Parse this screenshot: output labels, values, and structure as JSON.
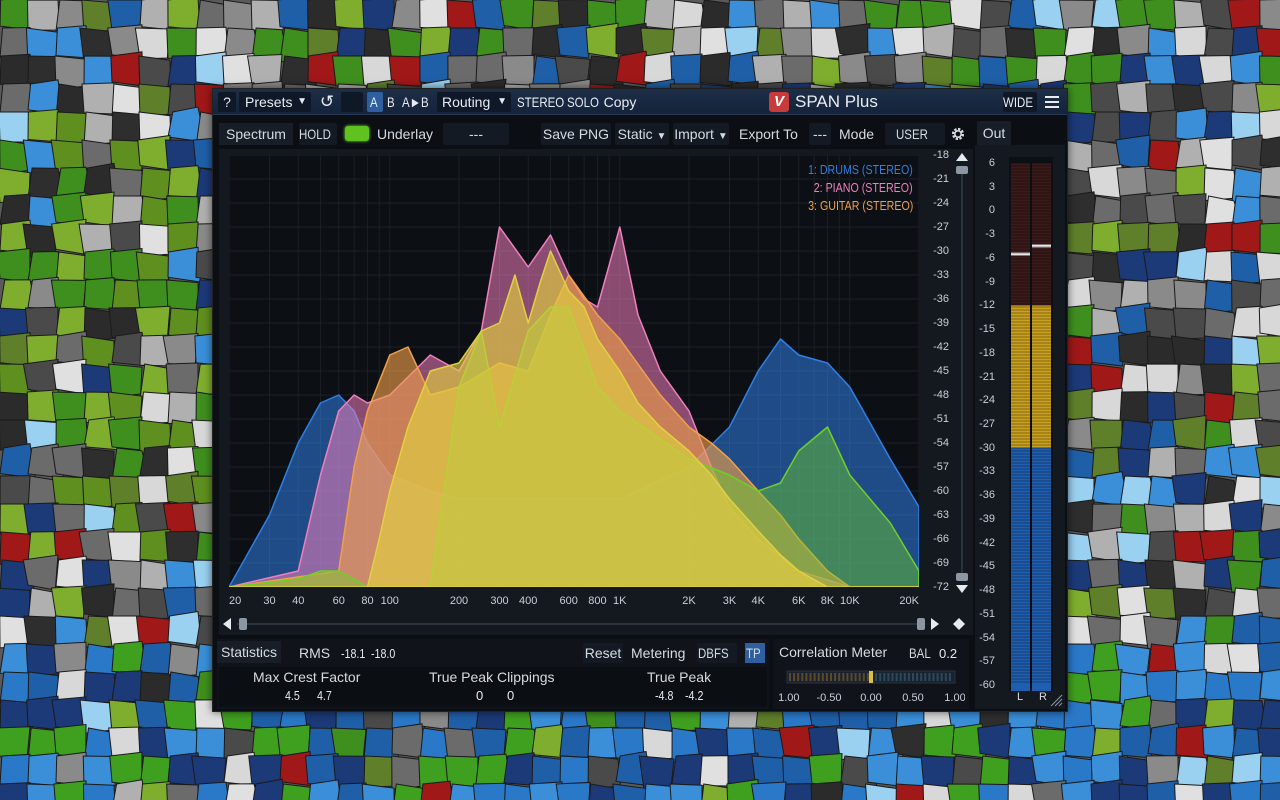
{
  "topbar": {
    "help": "?",
    "presets": "Presets",
    "undo_icon": "undo-icon",
    "slot_a": "A",
    "slot_b": "B",
    "a_to_b": "A►B",
    "routing": "Routing",
    "stereo": "STEREO",
    "solo": "SOLO",
    "copy": "Copy",
    "product": "SPAN Plus",
    "logo_letter": "V",
    "wide": "WIDE",
    "menu_icon": "hamburger-menu-icon"
  },
  "spectrum_header": {
    "tab": "Spectrum",
    "hold": "HOLD",
    "underlay_label": "Underlay",
    "underlay_value": "---",
    "save_png": "Save PNG",
    "static": "Static",
    "import": "Import",
    "export_to": "Export To",
    "export_value": "---",
    "mode_label": "Mode",
    "mode_value": "USER",
    "settings_icon": "gear-icon"
  },
  "out_tab": "Out",
  "legend": [
    {
      "label": "1: DRUMS (STEREO)",
      "color": "#2f7fe6"
    },
    {
      "label": "2: PIANO (STEREO)",
      "color": "#f07fbe"
    },
    {
      "label": "3: GUITAR (STEREO)",
      "color": "#f0a04a"
    }
  ],
  "chart_data": {
    "type": "area",
    "x_scale": "log",
    "xlabel": "",
    "ylabel": "",
    "xlim": [
      20,
      20000
    ],
    "ylim": [
      -72,
      -18
    ],
    "x_ticks": [
      "20",
      "30",
      "40",
      "60",
      "80",
      "100",
      "200",
      "300",
      "400",
      "600",
      "800",
      "1K",
      "2K",
      "3K",
      "4K",
      "6K",
      "8K",
      "10K",
      "20K"
    ],
    "y_ticks": [
      "-18",
      "-21",
      "-24",
      "-27",
      "-30",
      "-33",
      "-36",
      "-39",
      "-42",
      "-45",
      "-48",
      "-51",
      "-54",
      "-57",
      "-60",
      "-63",
      "-66",
      "-69",
      "-72"
    ],
    "series": [
      {
        "name": "1: DRUMS (STEREO)",
        "color": "#2f7fe6",
        "x": [
          20,
          30,
          40,
          50,
          60,
          70,
          80,
          100,
          150,
          200,
          300,
          400,
          600,
          800,
          1000,
          2000,
          3000,
          4000,
          5000,
          6000,
          8000,
          10000,
          15000,
          20000
        ],
        "y": [
          -72,
          -63,
          -54,
          -49,
          -48,
          -50,
          -54,
          -58,
          -60,
          -61,
          -61,
          -61,
          -61,
          -61,
          -61,
          -57,
          -52,
          -45,
          -41,
          -43,
          -44,
          -47,
          -56,
          -62
        ]
      },
      {
        "name": "2: PIANO (STEREO)",
        "color": "#f07fbe",
        "x": [
          20,
          40,
          50,
          60,
          70,
          80,
          100,
          150,
          200,
          250,
          300,
          400,
          500,
          600,
          700,
          800,
          1000,
          1200,
          1500,
          2000,
          2500,
          3000,
          4000,
          6000,
          10000,
          20000
        ],
        "y": [
          -72,
          -70,
          -58,
          -50,
          -48,
          -49,
          -48,
          -43,
          -45,
          -40,
          -27,
          -32,
          -28,
          -33,
          -36,
          -37,
          -27,
          -38,
          -45,
          -50,
          -57,
          -62,
          -66,
          -70,
          -72,
          -72
        ]
      },
      {
        "name": "3: GUITAR (STEREO)",
        "color": "#f0a04a",
        "x": [
          20,
          60,
          70,
          80,
          100,
          120,
          150,
          200,
          300,
          400,
          500,
          600,
          800,
          1000,
          1500,
          2000,
          2500,
          3000,
          4000,
          5000,
          6000,
          8000,
          10000,
          20000
        ],
        "y": [
          -72,
          -70,
          -57,
          -50,
          -43,
          -42,
          -48,
          -47,
          -44,
          -45,
          -38,
          -33,
          -38,
          -41,
          -48,
          -52,
          -54,
          -56,
          -60,
          -63,
          -66,
          -70,
          -72,
          -72
        ]
      },
      {
        "name": "",
        "color": "#e2d040",
        "x": [
          20,
          80,
          90,
          100,
          120,
          150,
          200,
          250,
          300,
          350,
          400,
          450,
          500,
          600,
          700,
          800,
          1000,
          1200,
          1500,
          2000,
          2500,
          3000,
          4000,
          5000,
          6000,
          8000,
          10000,
          15000,
          20000
        ],
        "y": [
          -72,
          -72,
          -66,
          -60,
          -52,
          -45,
          -44,
          -40,
          -39,
          -33,
          -39,
          -34,
          -30,
          -35,
          -37,
          -41,
          -45,
          -49,
          -52,
          -55,
          -58,
          -61,
          -65,
          -68,
          -70,
          -72,
          -72,
          -72,
          -72
        ]
      },
      {
        "name": "",
        "color": "#6fcf2a",
        "x": [
          20,
          40,
          50,
          60,
          70,
          80,
          100,
          150,
          200,
          250,
          300,
          400,
          500,
          600,
          800,
          1000,
          2000,
          3000,
          4000,
          5000,
          6000,
          8000,
          10000,
          15000,
          20000
        ],
        "y": [
          -72,
          -71,
          -70,
          -70,
          -71,
          -72,
          -72,
          -72,
          -47,
          -40,
          -52,
          -40,
          -37,
          -37,
          -47,
          -50,
          -56,
          -58,
          -60,
          -59,
          -55,
          -52,
          -58,
          -64,
          -70
        ]
      }
    ]
  },
  "statistics": {
    "tab": "Statistics",
    "rms_label": "RMS",
    "rms_l": "-18.1",
    "rms_r": "-18.0",
    "reset": "Reset",
    "metering_label": "Metering",
    "metering_value": "DBFS",
    "tp": "TP",
    "crest_label": "Max Crest Factor",
    "crest_l": "4.5",
    "crest_r": "4.7",
    "clip_label": "True Peak Clippings",
    "clip_l": "0",
    "clip_r": "0",
    "tpk_label": "True Peak",
    "tpk_l": "-4.8",
    "tpk_r": "-4.2"
  },
  "correlation": {
    "title": "Correlation Meter",
    "bal_label": "BAL",
    "bal_value": "0.2",
    "value": 0.0,
    "ticks": [
      "-1.00",
      "-0.50",
      "0.00",
      "0.50",
      "1.00"
    ]
  },
  "out_meter": {
    "ticks": [
      "6",
      "3",
      "0",
      "-3",
      "-6",
      "-9",
      "-12",
      "-15",
      "-18",
      "-21",
      "-24",
      "-27",
      "-30",
      "-33",
      "-36",
      "-39",
      "-42",
      "-45",
      "-48",
      "-51",
      "-54",
      "-57",
      "-60"
    ],
    "left_label": "L",
    "right_label": "R",
    "left_level_db": -12,
    "right_level_db": -12,
    "left_peak_db": -5.5,
    "right_peak_db": -4.5
  }
}
